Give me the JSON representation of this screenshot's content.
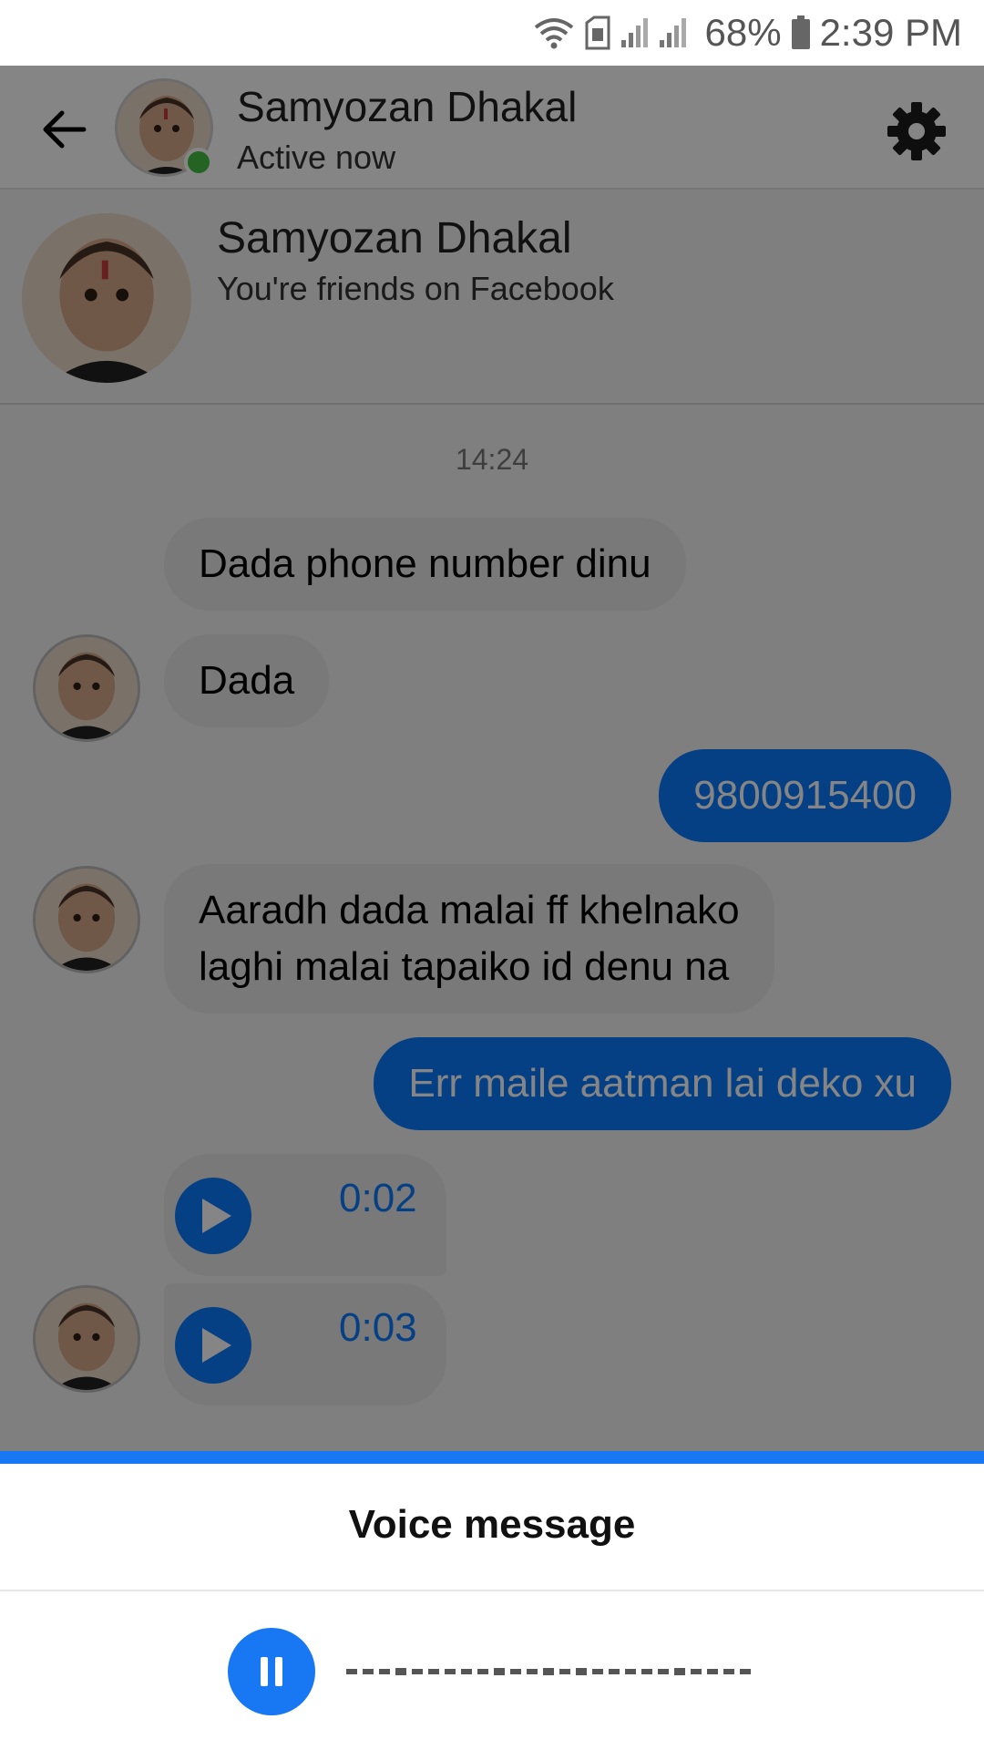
{
  "status_bar": {
    "battery": "68%",
    "time": "2:39 PM"
  },
  "header": {
    "name": "Samyozan Dhakal",
    "status": "Active now"
  },
  "profile": {
    "name": "Samyozan Dhakal",
    "subtitle": "You're friends on Facebook"
  },
  "conversation": {
    "timestamp": "14:24",
    "messages": [
      {
        "text": "Dada phone number dinu"
      },
      {
        "text": "Dada"
      },
      {
        "text": "9800915400"
      },
      {
        "line1": "Aaradh dada malai ff khelnako",
        "line2": "laghi malai tapaiko id denu na"
      },
      {
        "text": "Err maile aatman lai deko xu"
      }
    ],
    "voice_messages": [
      {
        "duration": "0:02"
      },
      {
        "duration": "0:03"
      }
    ]
  },
  "sheet": {
    "title": "Voice message"
  },
  "colors": {
    "accent": "#1877f2",
    "bubble_out": "#0a7cff",
    "bubble_in": "#e9e9ea",
    "online": "#44c043"
  },
  "icons": [
    "wifi-icon",
    "sim-icon",
    "signal-icon",
    "battery-icon",
    "back-arrow-icon",
    "gear-icon",
    "play-icon",
    "emoji-icon",
    "plus-icon",
    "pause-icon"
  ]
}
